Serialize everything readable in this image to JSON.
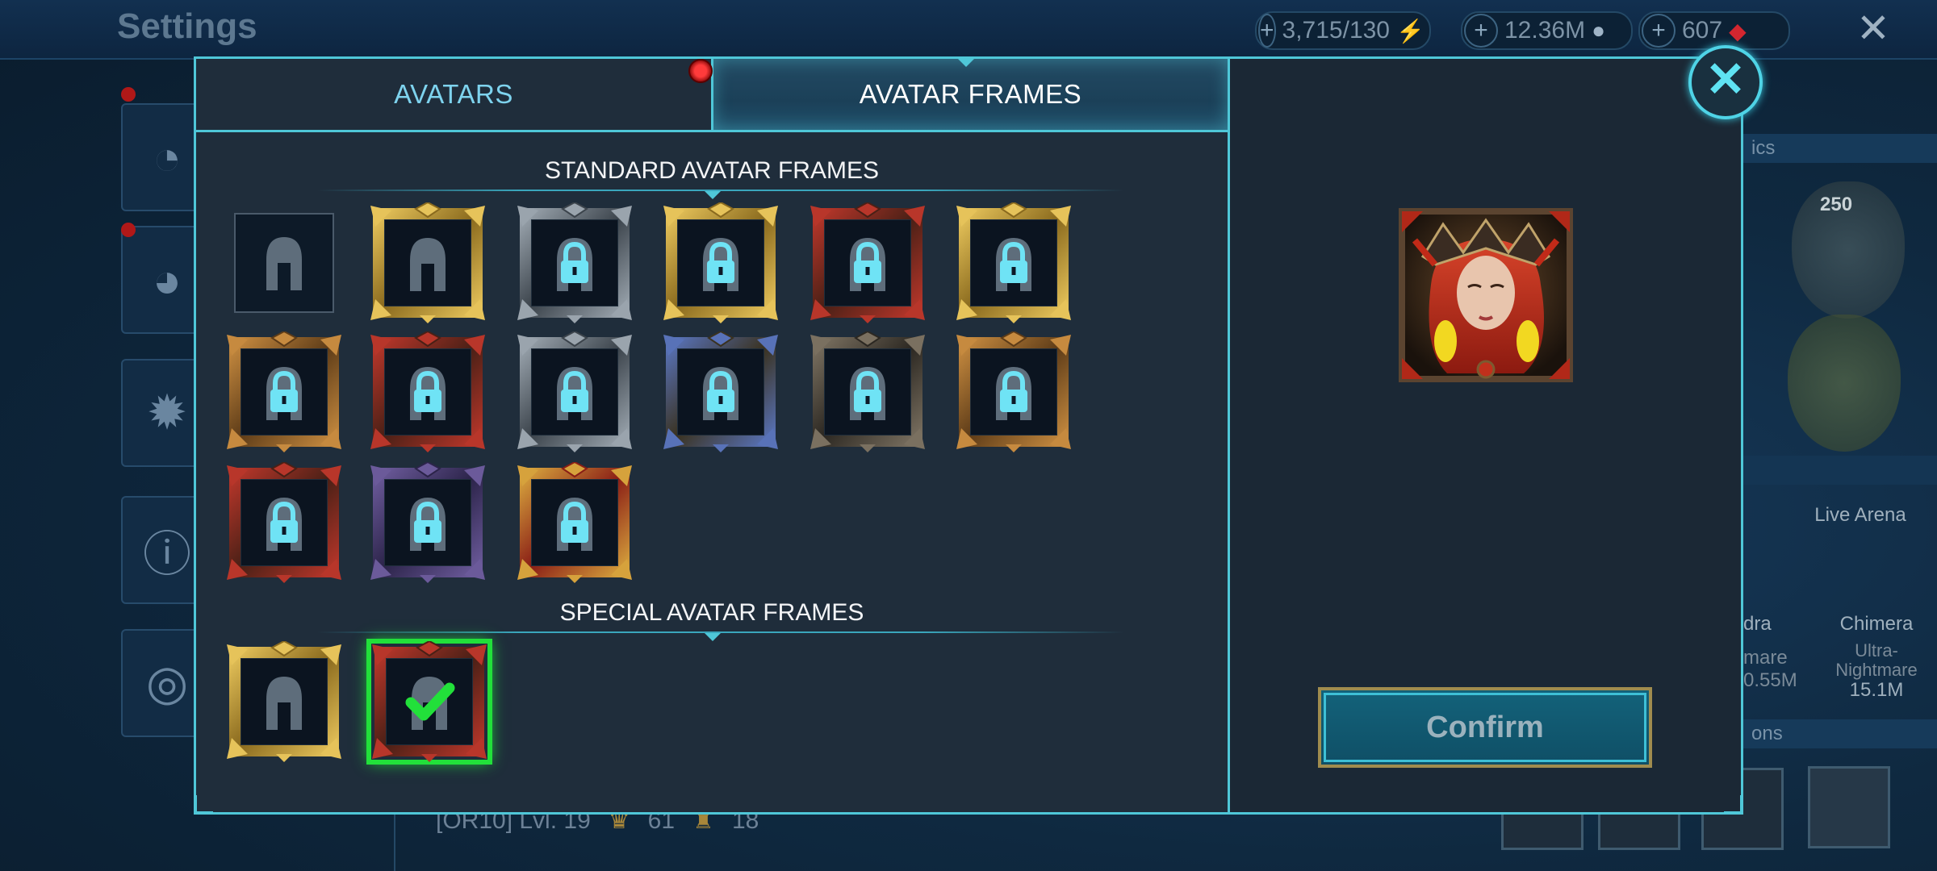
{
  "background": {
    "title": "Settings",
    "resources": [
      {
        "value": "3,715/130",
        "icon": "energy-icon",
        "icon_color": "#7cc63b"
      },
      {
        "value": "12.36M",
        "icon": "silver-icon",
        "icon_color": "#9fb4c7"
      },
      {
        "value": "607",
        "icon": "gem-icon",
        "icon_color": "#d3262f"
      }
    ],
    "footer": {
      "clan": "[OR10] Lvl. 19",
      "stat1": "61",
      "stat2": "18"
    },
    "right": {
      "strip1": "ics",
      "arena_label": "Live Arena",
      "hydra_label": "dra",
      "hydra_sub": "mare",
      "hydra_val": "0.55M",
      "chimera_label": "Chimera",
      "chimera_sub1": "Ultra-",
      "chimera_sub2": "Nightmare",
      "chimera_val": "15.1M",
      "strip2": "ons",
      "emblem_level": "250"
    }
  },
  "tabs": {
    "avatars": "AVATARS",
    "avatar_frames": "AVATAR FRAMES",
    "active": "avatar_frames"
  },
  "sections": {
    "standard_title": "STANDARD AVATAR FRAMES",
    "special_title": "SPECIAL AVATAR FRAMES"
  },
  "standard_frames": [
    {
      "name": "default",
      "locked": false,
      "style": "plain"
    },
    {
      "name": "gold-vine",
      "locked": false,
      "style": "gold"
    },
    {
      "name": "dark-spire",
      "locked": true,
      "style": "silver"
    },
    {
      "name": "gold-spike",
      "locked": true,
      "style": "gold"
    },
    {
      "name": "red-serpent",
      "locked": true,
      "style": "red"
    },
    {
      "name": "gold-crown",
      "locked": true,
      "style": "gold"
    },
    {
      "name": "bronze-temple",
      "locked": true,
      "style": "bronze"
    },
    {
      "name": "crimson-wing",
      "locked": true,
      "style": "red"
    },
    {
      "name": "silver-bat",
      "locked": true,
      "style": "silver"
    },
    {
      "name": "blue-dragon",
      "locked": true,
      "style": "blue"
    },
    {
      "name": "iron-chain",
      "locked": true,
      "style": "iron"
    },
    {
      "name": "bronze-thorn",
      "locked": true,
      "style": "bronze"
    },
    {
      "name": "ruby-spike",
      "locked": true,
      "style": "red"
    },
    {
      "name": "violet-arch",
      "locked": true,
      "style": "violet"
    },
    {
      "name": "gold-tower",
      "locked": true,
      "style": "redgold"
    }
  ],
  "special_frames": [
    {
      "name": "gold-laurel",
      "locked": false,
      "selected": false,
      "style": "gold"
    },
    {
      "name": "demon-horn",
      "locked": false,
      "selected": true,
      "style": "red"
    }
  ],
  "preview": {
    "alt": "red-haired-champion-portrait"
  },
  "confirm_label": "Confirm",
  "colors": {
    "accent": "#4fc7d8",
    "selected": "#22e03a",
    "lock": "#6fe3f5"
  }
}
